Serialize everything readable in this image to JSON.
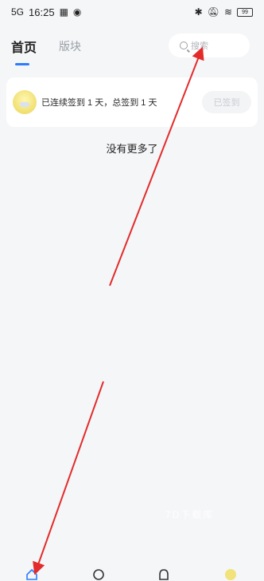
{
  "status_bar": {
    "time": "16:25",
    "signal": "5G",
    "battery": "99"
  },
  "top_nav": {
    "tabs": [
      "首页",
      "版块"
    ],
    "search_placeholder": "搜索"
  },
  "checkin": {
    "text": "已连续签到 1 天，总签到 1 天",
    "button_label": "已签到"
  },
  "feed": {
    "empty_text": "没有更多了"
  },
  "watermark": "7D下载库",
  "colors": {
    "accent": "#2b7cff",
    "annotation": "#e32b2b"
  },
  "icons": {
    "nav": [
      "home-icon",
      "discover-icon",
      "message-icon",
      "profile-icon"
    ]
  }
}
